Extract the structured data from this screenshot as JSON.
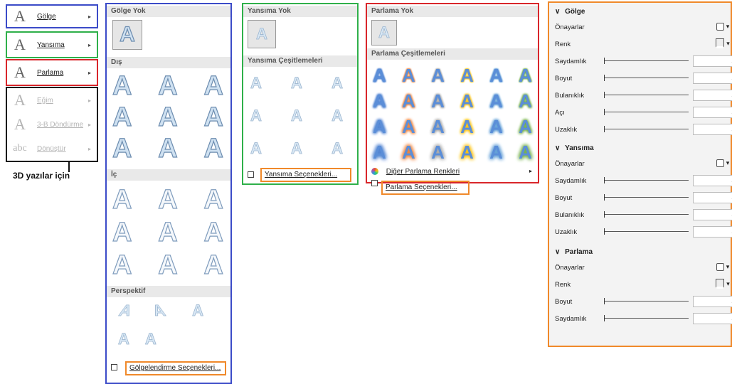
{
  "left_menu": {
    "items": [
      {
        "label": "Gölge",
        "icon": "A",
        "disabled": false
      },
      {
        "label": "Yansıma",
        "icon": "A",
        "disabled": false
      },
      {
        "label": "Parlama",
        "icon": "A",
        "disabled": false
      },
      {
        "label": "Eğim",
        "icon": "A",
        "disabled": true
      },
      {
        "label": "3-B Döndürme",
        "icon": "A",
        "disabled": true
      },
      {
        "label": "Dönüştür",
        "icon": "abc",
        "disabled": true
      }
    ],
    "caption": "3D yazılar için"
  },
  "shadow_panel": {
    "none_label": "Gölge Yok",
    "outer_label": "Dış",
    "inner_label": "İç",
    "perspective_label": "Perspektif",
    "options_label": "Gölgelendirme Seçenekleri...",
    "glyph": "A"
  },
  "reflection_panel": {
    "none_label": "Yansıma Yok",
    "variations_label": "Yansıma Çeşitlemeleri",
    "options_label": "Yansıma Seçenekleri...",
    "glyph": "A"
  },
  "glow_panel": {
    "none_label": "Parlama Yok",
    "variations_label": "Parlama Çeşitlemeleri",
    "more_colors_label": "Diğer Parlama Renkleri",
    "options_label": "Parlama Seçenekleri...",
    "glyph": "A",
    "glow_colors": [
      "#4a7fd0",
      "#ee7d31",
      "#a5a5a5",
      "#ffc000",
      "#5b9bd5",
      "#70ad47"
    ]
  },
  "format_pane": {
    "shadow": {
      "title": "Gölge",
      "rows": [
        "Önayarlar",
        "Renk",
        "Saydamlık",
        "Boyut",
        "Bulanıklık",
        "Açı",
        "Uzaklık"
      ]
    },
    "reflection": {
      "title": "Yansıma",
      "rows": [
        "Önayarlar",
        "Saydamlık",
        "Boyut",
        "Bulanıklık",
        "Uzaklık"
      ]
    },
    "glow": {
      "title": "Parlama",
      "rows": [
        "Önayarlar",
        "Renk",
        "Boyut",
        "Saydamlık"
      ]
    },
    "caret_icon": "▾",
    "collapse_icon": "∨"
  },
  "colors": {
    "blue_frame": "#3b4bc8",
    "green_frame": "#2fb04a",
    "red_frame": "#d9262b",
    "orange_frame": "#f0892a"
  }
}
